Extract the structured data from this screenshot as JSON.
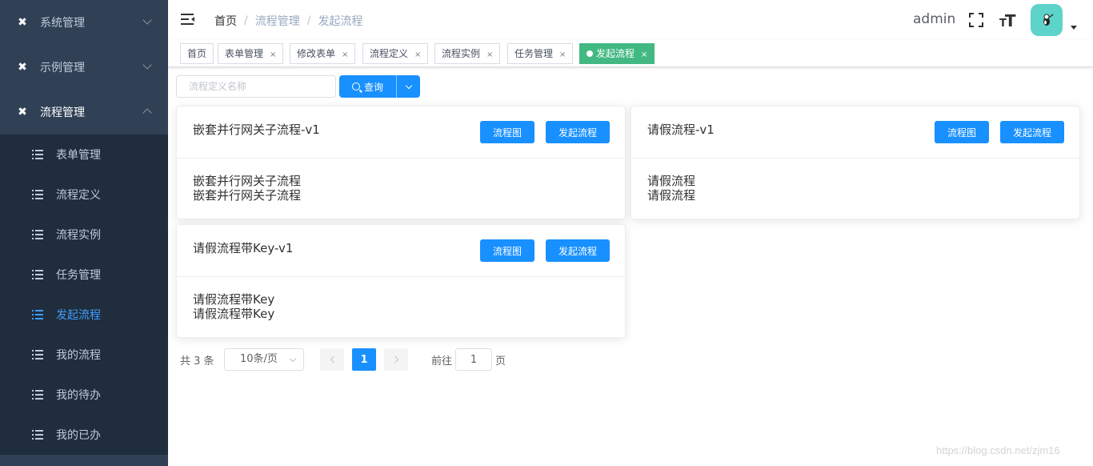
{
  "sidebar": {
    "menus": [
      {
        "label": "系统管理",
        "icon": "tools-icon",
        "expanded": false
      },
      {
        "label": "示例管理",
        "icon": "tools-icon",
        "expanded": false
      },
      {
        "label": "流程管理",
        "icon": "tools-icon",
        "expanded": true
      }
    ],
    "subitems": [
      {
        "label": "表单管理"
      },
      {
        "label": "流程定义"
      },
      {
        "label": "流程实例"
      },
      {
        "label": "任务管理"
      },
      {
        "label": "发起流程",
        "active": true
      },
      {
        "label": "我的流程"
      },
      {
        "label": "我的待办"
      },
      {
        "label": "我的已办"
      }
    ],
    "active_color": "#409eff",
    "background": "#304156"
  },
  "navbar": {
    "breadcrumb": [
      "首页",
      "流程管理",
      "发起流程"
    ],
    "separator": "/",
    "user": "admin",
    "size_icon_label": "T",
    "size_icon_big": "T"
  },
  "tags": [
    {
      "label": "首页",
      "closable": false
    },
    {
      "label": "表单管理",
      "closable": true
    },
    {
      "label": "修改表单",
      "closable": true
    },
    {
      "label": "流程定义",
      "closable": true
    },
    {
      "label": "流程实例",
      "closable": true
    },
    {
      "label": "任务管理",
      "closable": true
    },
    {
      "label": "发起流程",
      "closable": true,
      "active": true
    }
  ],
  "tag_close": "×",
  "search": {
    "placeholder": "流程定义名称",
    "button_label": "查询"
  },
  "cards": [
    {
      "title": "嵌套并行网关子流程-v1",
      "btn_flow": "流程图",
      "btn_start": "发起流程",
      "line1": "嵌套并行网关子流程",
      "line2": "嵌套并行网关子流程"
    },
    {
      "title": "请假流程-v1",
      "btn_flow": "流程图",
      "btn_start": "发起流程",
      "line1": "请假流程",
      "line2": "请假流程"
    },
    {
      "title": "请假流程带Key-v1",
      "btn_flow": "流程图",
      "btn_start": "发起流程",
      "line1": "请假流程带Key",
      "line2": "请假流程带Key"
    }
  ],
  "pagination": {
    "total": "共 3 条",
    "page_size": "10条/页",
    "current": "1",
    "goto_label": "前往",
    "goto_value": "1",
    "page_unit": "页"
  },
  "colors": {
    "primary": "#1890ff",
    "tag_active": "#42b983",
    "avatar_bg": "#5dd3c9"
  },
  "watermark": "https://blog.csdn.net/zjm16"
}
